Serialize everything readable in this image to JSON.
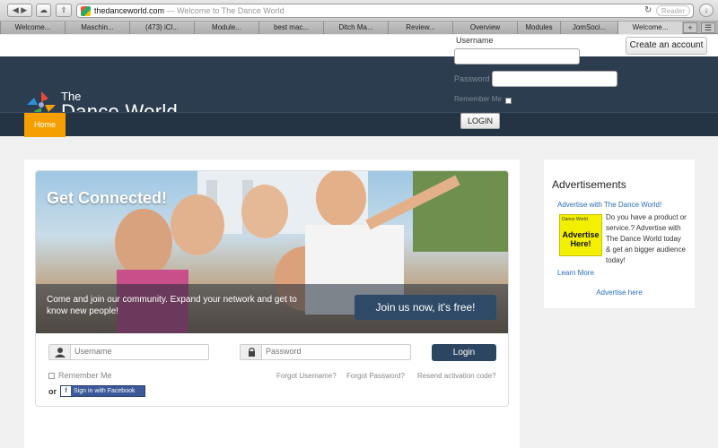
{
  "browser": {
    "url": "thedanceworld.com",
    "page_title": "— Welcome to The Dance World",
    "reader_label": "Reader",
    "tabs": [
      "Welcome...",
      "Maschin...",
      "(473) iCl...",
      "Module...",
      "best mac...",
      "Ditch Ma...",
      "Review...",
      "Overview",
      "Modules",
      "JomSoci...",
      "Welcome..."
    ],
    "new_tab": "+"
  },
  "header_login": {
    "username_label": "Username",
    "password_label": "Password",
    "remember_label": "Remember Me",
    "login_button": "LOGIN",
    "create_account": "Create an account"
  },
  "logo": {
    "the": "The",
    "name": "Dance World"
  },
  "nav": {
    "home": "Home"
  },
  "hero": {
    "title": "Get Connected!",
    "text": "Come and join our community. Expand your network and get to know new people!",
    "join_button": "Join us now, it's free!"
  },
  "login_form": {
    "username_placeholder": "Username",
    "password_placeholder": "Password",
    "login_button": "Login",
    "remember_label": "Remember Me",
    "forgot_username": "Forgot Username?",
    "forgot_password": "Forgot Password?",
    "resend": "Resend activation code?",
    "or_label": "or",
    "facebook_button": "Sign in with Facebook"
  },
  "sidebar": {
    "title": "Advertisements",
    "ad_link": "Advertise with The Dance World!",
    "ad_image_small": "Dance World",
    "ad_image_big": "Advertise Here!",
    "ad_text": "Do you have a product or service.? Advertise with The Dance World today & get an bigger audience today!",
    "learn_more": "Learn More",
    "advertise_here": "Advertise here"
  }
}
